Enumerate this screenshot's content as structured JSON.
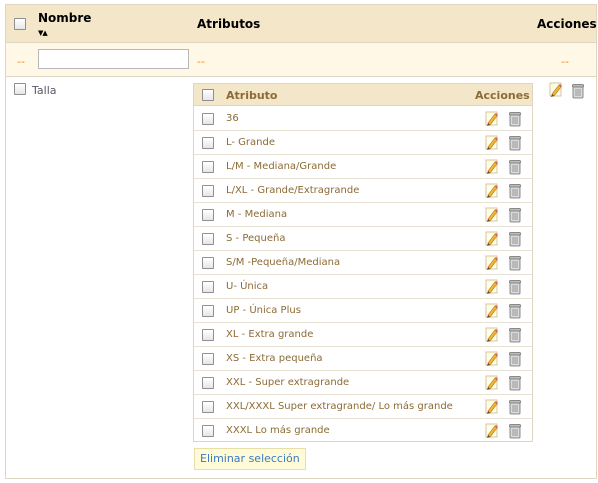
{
  "table": {
    "headers": {
      "name": "Nombre",
      "attributes": "Atributos",
      "actions": "Acciones"
    },
    "sort_arrows": "▼▲",
    "filter": {
      "left_dash": "--",
      "name_value": "",
      "attributes_dash": "--",
      "actions_dash": "--"
    },
    "group": {
      "name": "Talla"
    }
  },
  "attributes_table": {
    "headers": {
      "attribute": "Atributo",
      "actions": "Acciones"
    },
    "rows": [
      {
        "label": "36"
      },
      {
        "label": "L- Grande"
      },
      {
        "label": "L/M - Mediana/Grande"
      },
      {
        "label": "L/XL - Grande/Extragrande"
      },
      {
        "label": "M - Mediana"
      },
      {
        "label": "S - Pequeña"
      },
      {
        "label": "S/M -Pequeña/Mediana"
      },
      {
        "label": "U- Única"
      },
      {
        "label": "UP - Única Plus"
      },
      {
        "label": "XL - Extra grande"
      },
      {
        "label": "XS - Extra pequeña"
      },
      {
        "label": "XXL - Super extragrande"
      },
      {
        "label": "XXL/XXXL Super extragrande/ Lo más grande"
      },
      {
        "label": "XXXL Lo más grande"
      }
    ]
  },
  "bulk_action": {
    "delete_label": "Eliminar selección"
  },
  "colors": {
    "header_bg": "#f4e6c9",
    "filter_bg": "#fff8e6",
    "link": "#3a7bbf",
    "label_brown": "#8c6b35",
    "dash_orange": "#f28a1c"
  },
  "icons": [
    "edit-pencil-icon",
    "delete-bin-icon"
  ]
}
